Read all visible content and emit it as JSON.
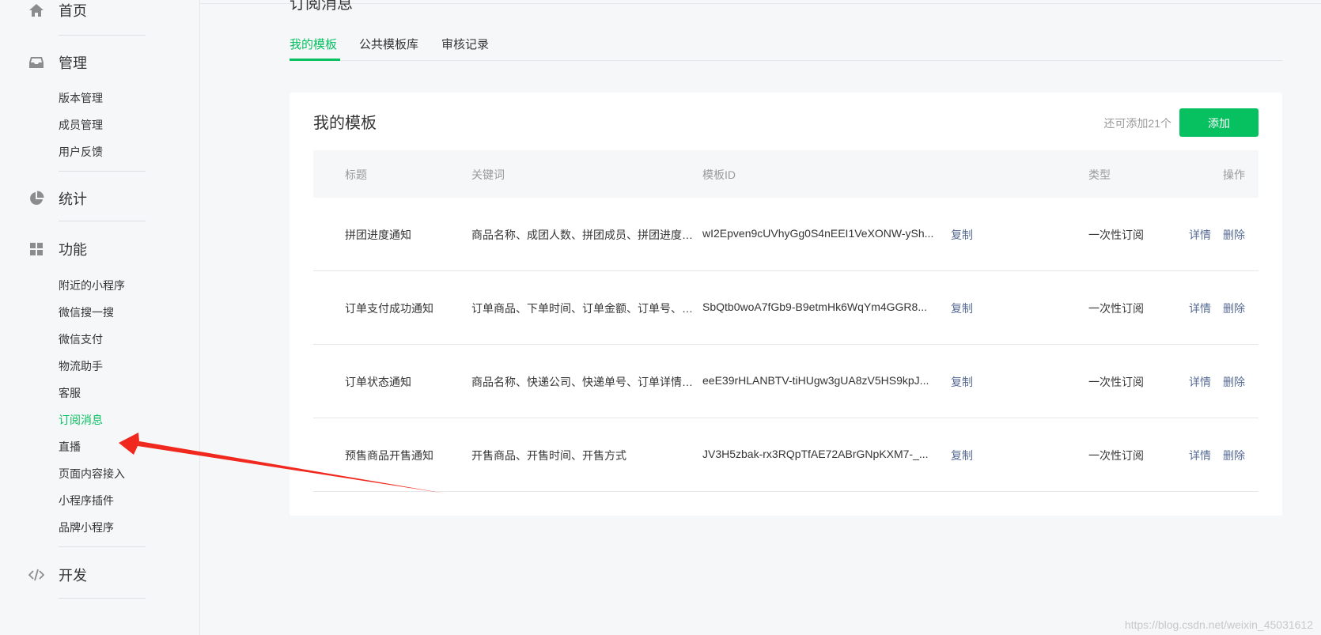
{
  "sidebar": {
    "home": {
      "title": "首页",
      "icon": "home-icon"
    },
    "manage": {
      "title": "管理",
      "icon": "inbox-icon",
      "items": [
        "版本管理",
        "成员管理",
        "用户反馈"
      ]
    },
    "stats": {
      "title": "统计",
      "icon": "pie-chart-icon"
    },
    "features": {
      "title": "功能",
      "icon": "grid-icon",
      "items": [
        "附近的小程序",
        "微信搜一搜",
        "微信支付",
        "物流助手",
        "客服",
        "订阅消息",
        "直播",
        "页面内容接入",
        "小程序插件",
        "品牌小程序"
      ],
      "active_index": 5
    },
    "develop": {
      "title": "开发",
      "icon": "code-icon"
    }
  },
  "main": {
    "page_title": "订阅消息",
    "tabs": [
      "我的模板",
      "公共模板库",
      "审核记录"
    ],
    "active_tab": 0
  },
  "card": {
    "title": "我的模板",
    "remain_text": "还可添加21个",
    "add_label": "添加",
    "columns": [
      "标题",
      "关键词",
      "模板ID",
      "类型",
      "操作"
    ],
    "rows": [
      {
        "title": "拼团进度通知",
        "keywords": "商品名称、成团人数、拼团成员、拼团进度、备注",
        "id": "wI2Epven9cUVhyGg0S4nEEI1VeXONW-ySh...",
        "copy": "复制",
        "type": "一次性订阅",
        "detail": "详情",
        "delete": "删除"
      },
      {
        "title": "订单支付成功通知",
        "keywords": "订单商品、下单时间、订单金额、订单号、支付方式",
        "id": "SbQtb0woA7fGb9-B9etmHk6WqYm4GGR8...",
        "copy": "复制",
        "type": "一次性订阅",
        "detail": "详情",
        "delete": "删除"
      },
      {
        "title": "订单状态通知",
        "keywords": "商品名称、快递公司、快递单号、订单详情、备注",
        "id": "eeE39rHLANBTV-tiHUgw3gUA8zV5HS9kpJ...",
        "copy": "复制",
        "type": "一次性订阅",
        "detail": "详情",
        "delete": "删除"
      },
      {
        "title": "预售商品开售通知",
        "keywords": "开售商品、开售时间、开售方式",
        "id": "JV3H5zbak-rx3RQpTfAE72ABrGNpKXM7-_...",
        "copy": "复制",
        "type": "一次性订阅",
        "detail": "详情",
        "delete": "删除"
      }
    ]
  },
  "annotation": {
    "arrow_color": "#f0281e"
  },
  "watermark": "https://blog.csdn.net/weixin_45031612",
  "colors": {
    "accent": "#07c160",
    "link": "#576b95",
    "muted": "#9a9a9a"
  }
}
